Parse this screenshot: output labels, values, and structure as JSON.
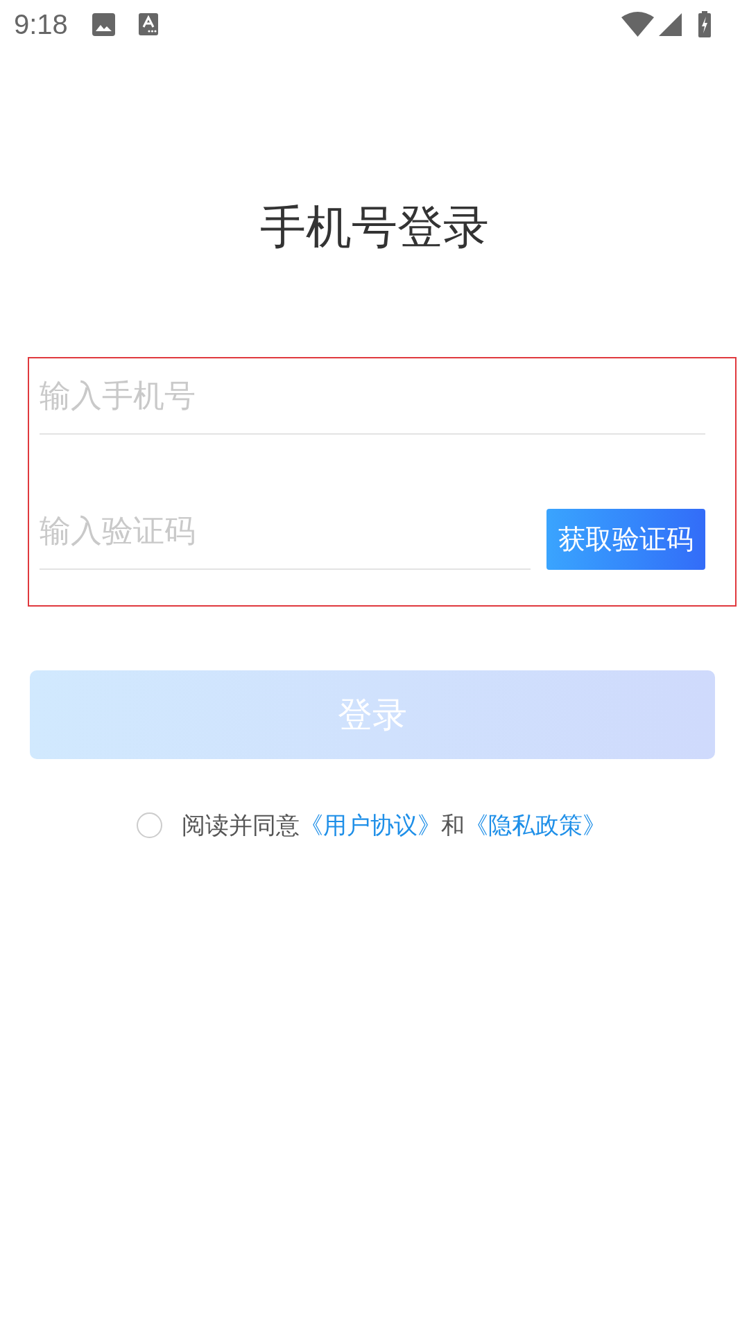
{
  "status_bar": {
    "time": "9:18"
  },
  "title": "手机号登录",
  "form": {
    "highlighted": true,
    "phone_field": {
      "placeholder": "输入手机号"
    },
    "code_field": {
      "placeholder": "输入验证码"
    },
    "get_code_button": {
      "label": "获取验证码"
    }
  },
  "login_button": {
    "label": "登录",
    "disabled": true
  },
  "agreement": {
    "checked": false,
    "parts": [
      {
        "kind": "text",
        "text": "阅读并同意"
      },
      {
        "kind": "link",
        "text": "《用户协议》"
      },
      {
        "kind": "text",
        "text": "和"
      },
      {
        "kind": "link",
        "text": "《隐私政策》"
      }
    ]
  }
}
